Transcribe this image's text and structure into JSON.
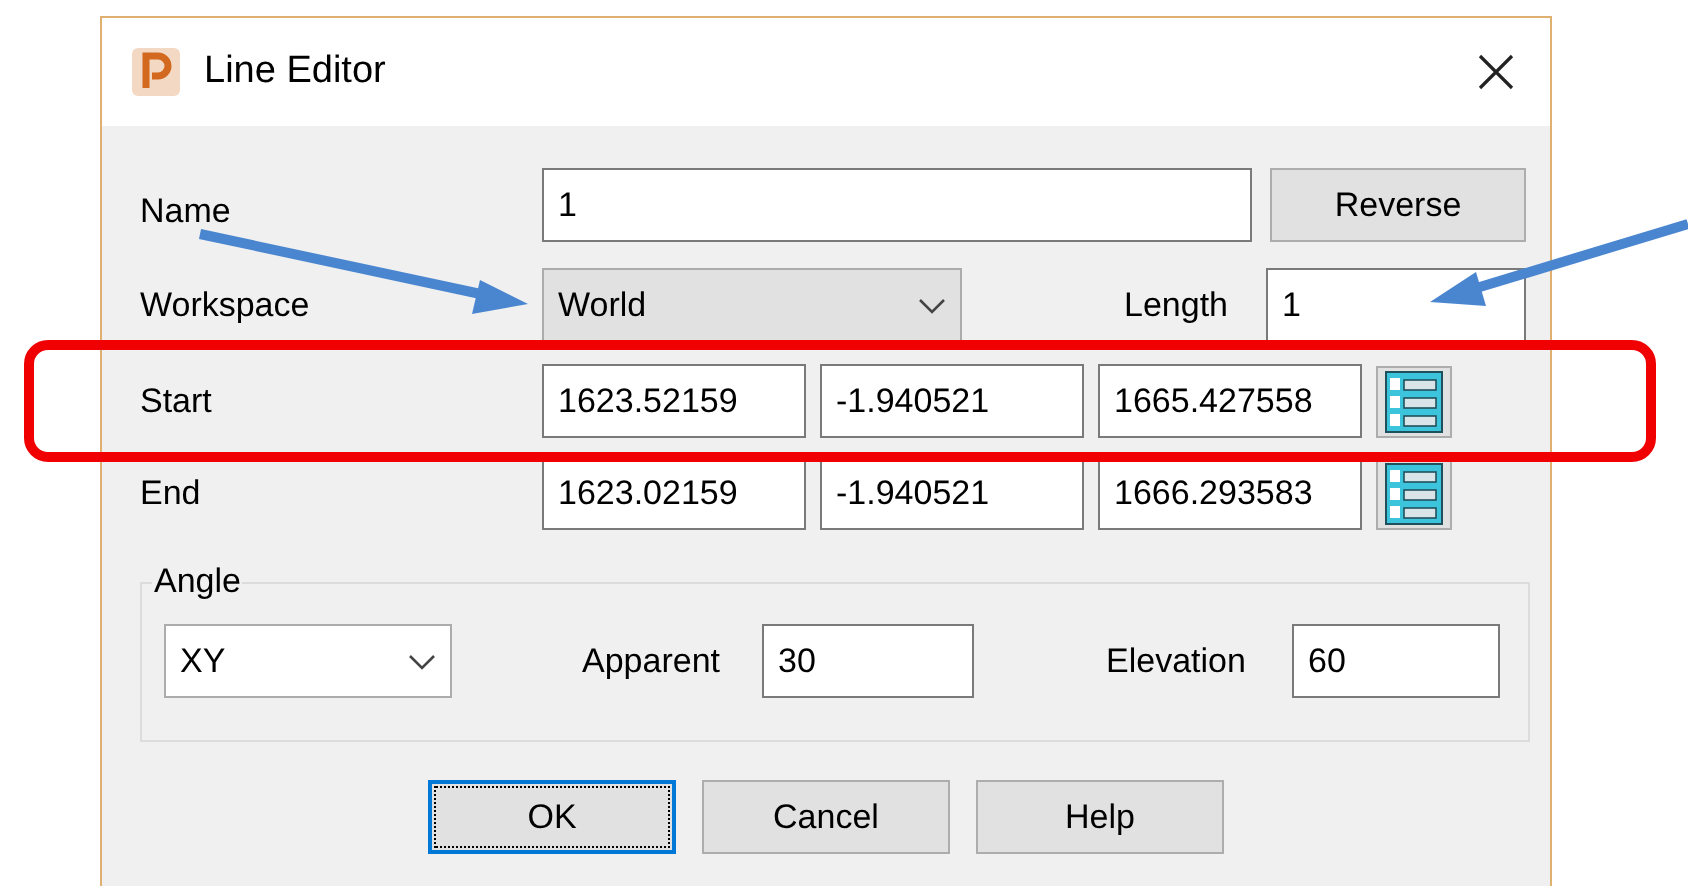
{
  "window": {
    "title": "Line Editor"
  },
  "name": {
    "label": "Name",
    "value": "1"
  },
  "reverse_button": "Reverse",
  "workspace": {
    "label": "Workspace",
    "value": "World"
  },
  "length": {
    "label": "Length",
    "value": "1"
  },
  "points": [
    {
      "label": "Start",
      "values": [
        "1623.52159",
        "-1.940521",
        "1665.427558"
      ]
    },
    {
      "label": "End",
      "values": [
        "1623.02159",
        "-1.940521",
        "1666.293583"
      ]
    }
  ],
  "angle": {
    "title": "Angle",
    "plane": "XY",
    "apparent": {
      "label": "Apparent",
      "value": "30"
    },
    "elevation": {
      "label": "Elevation",
      "value": "60"
    }
  },
  "buttons": [
    {
      "label": "OK",
      "focused": true
    },
    {
      "label": "Cancel",
      "focused": false
    },
    {
      "label": "Help",
      "focused": false
    }
  ]
}
